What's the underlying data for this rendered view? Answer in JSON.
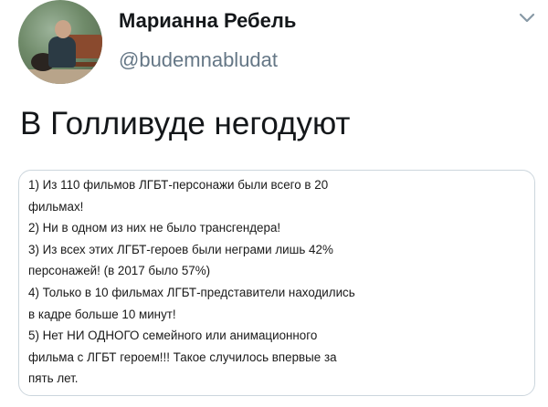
{
  "author": {
    "name": "Марианна Ребель",
    "handle": "@budemnabludat",
    "avatar_icon": "user-avatar-photo"
  },
  "menu_icon": "chevron-down-icon",
  "tweet": {
    "text": "В Голливуде негодуют"
  },
  "image_card": {
    "lines": [
      "1) Из 110 фильмов ЛГБТ-персонажи были всего в 20",
      "фильмах!",
      "2) Ни в одном из них не было трансгендера!",
      "3) Из всех этих ЛГБТ-героев были неграми лишь 42%",
      "персонажей! (в 2017 было 57%)",
      "4) Только в 10 фильмах ЛГБТ-представители находились",
      "в кадре больше 10 минут!",
      "5) Нет НИ ОДНОГО семейного или анимационного",
      "фильма с ЛГБТ героем!!! Такое случилось впервые за",
      "пять лет."
    ]
  },
  "colors": {
    "text": "#14171a",
    "secondary": "#657786",
    "border": "#ccd6dd"
  }
}
